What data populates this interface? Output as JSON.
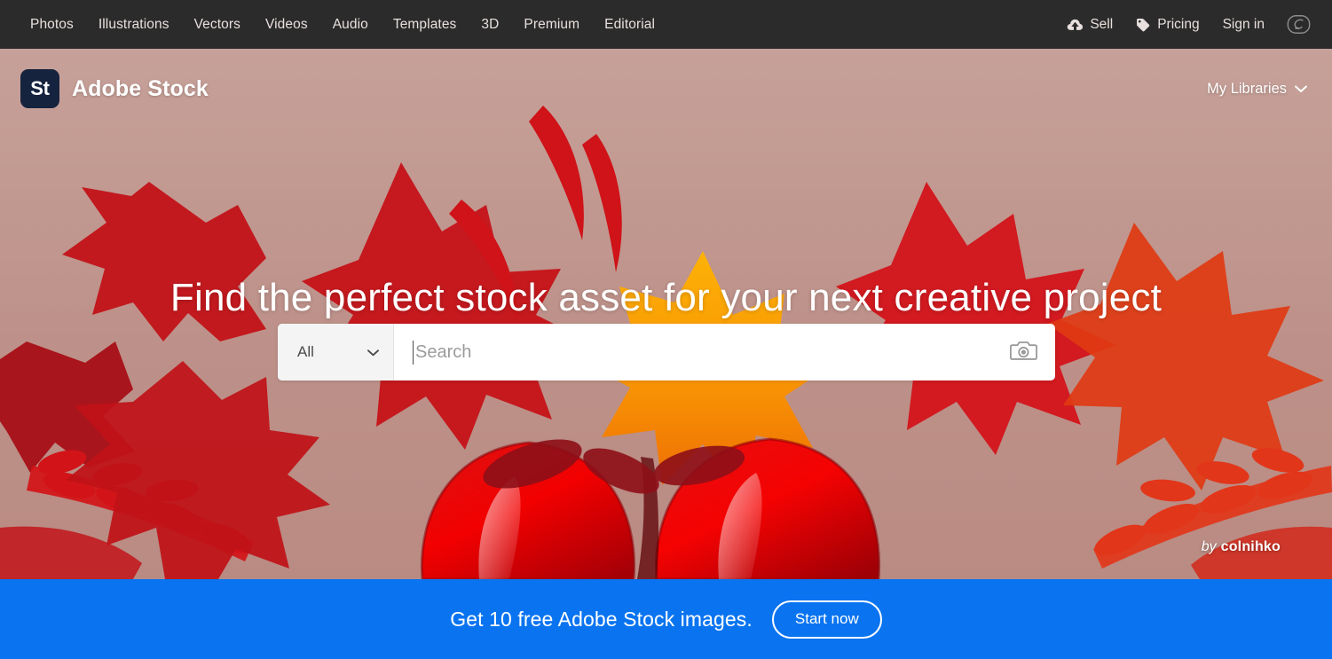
{
  "global_nav": {
    "left_items": [
      {
        "label": "Photos"
      },
      {
        "label": "Illustrations"
      },
      {
        "label": "Vectors"
      },
      {
        "label": "Videos"
      },
      {
        "label": "Audio"
      },
      {
        "label": "Templates"
      },
      {
        "label": "3D"
      },
      {
        "label": "Premium"
      },
      {
        "label": "Editorial"
      }
    ],
    "right_items": [
      {
        "label": "Sell",
        "icon": "cloud-upload-icon"
      },
      {
        "label": "Pricing",
        "icon": "price-tag-icon"
      },
      {
        "label": "Sign in",
        "icon": ""
      }
    ],
    "creative_cloud_icon": "adobe-creative-cloud-icon",
    "background_color": "#2b2b2b",
    "text_color": "#e8e0de"
  },
  "brand": {
    "mark": "St",
    "name": "Adobe Stock",
    "mark_color": "#16233f",
    "libraries_label": "My Libraries",
    "libraries_chevron": "chevron-down-icon"
  },
  "hero": {
    "headline": "Find the perfect stock asset for your next creative project",
    "background_color": "#c09a93",
    "attribution": {
      "prefix": "by",
      "author": "colnihko"
    }
  },
  "search": {
    "category_value": "All",
    "category_chevron": "chevron-down-icon",
    "placeholder": "Search",
    "value": "",
    "visual_search_icon": "camera-icon"
  },
  "promo": {
    "text": "Get 10 free Adobe Stock images.",
    "button_label": "Start now",
    "background_color": "#0a74f0"
  }
}
